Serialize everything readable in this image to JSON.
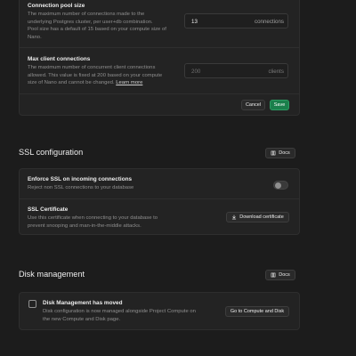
{
  "pool": {
    "title": "Connection pool size",
    "desc_line1": "The maximum number of connections made to the",
    "desc_line2": "underlying Postgres cluster, per user+db combination.",
    "desc_line3": "Pool size has a default of 15 based on your compute size of",
    "desc_line4": "Nano.",
    "value": "13",
    "unit": "connections"
  },
  "max_clients": {
    "title": "Max client connections",
    "desc_line1": "The maximum number of concurrent client connections",
    "desc_line2": "allowed. This value is fixed at 200 based on your compute",
    "desc_line3_prefix": "size of Nano and cannot be changed. ",
    "learn_more": "Learn more",
    "value": "200",
    "unit": "clients"
  },
  "actions": {
    "cancel": "Cancel",
    "save": "Save"
  },
  "ssl": {
    "title": "SSL configuration",
    "docs": "Docs",
    "enforce_title": "Enforce SSL on incoming connections",
    "enforce_desc": "Reject non SSL connections to your database",
    "enforce_on": false,
    "cert_title": "SSL Certificate",
    "cert_desc_line1": "Use this certificate when connecting to your database to",
    "cert_desc_line2": "prevent snooping and man-in-the-middle attacks.",
    "download": "Download certificate"
  },
  "disk": {
    "title": "Disk management",
    "docs": "Docs",
    "notice_title": "Disk Management has moved",
    "notice_line1": "Disk configuration is now managed alongside Project Compute on",
    "notice_line2": "the new Compute and Disk page.",
    "goto": "Go to Compute and Disk"
  }
}
